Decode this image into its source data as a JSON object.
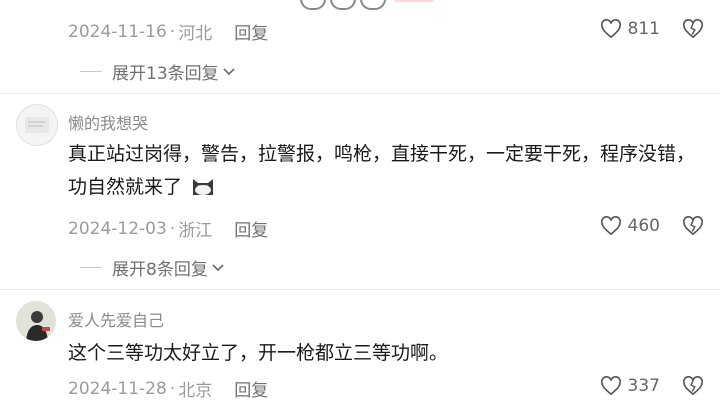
{
  "comments": [
    {
      "date": "2024-11-16",
      "location": "河北",
      "reply_label": "回复",
      "likes": "811",
      "expand_label": "展开13条回复"
    },
    {
      "username": "懒的我想哭",
      "text": "真正站过岗得，警告，拉警报，鸣枪，直接干死，一定要干死，程序没错，功自然就来了",
      "emoji": "cat-face-emoji",
      "date": "2024-12-03",
      "location": "浙江",
      "reply_label": "回复",
      "likes": "460",
      "expand_label": "展开8条回复"
    },
    {
      "username": "爱人先爱自己",
      "text": "这个三等功太好立了，开一枪都立三等功啊。",
      "date": "2024-11-28",
      "location": "北京",
      "reply_label": "回复",
      "likes": "337"
    }
  ],
  "icons": {
    "like": "heart-outline-icon",
    "dislike": "broken-heart-icon",
    "expand": "chevron-down-icon"
  },
  "colors": {
    "text": "#1a1a1a",
    "meta": "#9b9b9b",
    "divider": "#ececec"
  }
}
